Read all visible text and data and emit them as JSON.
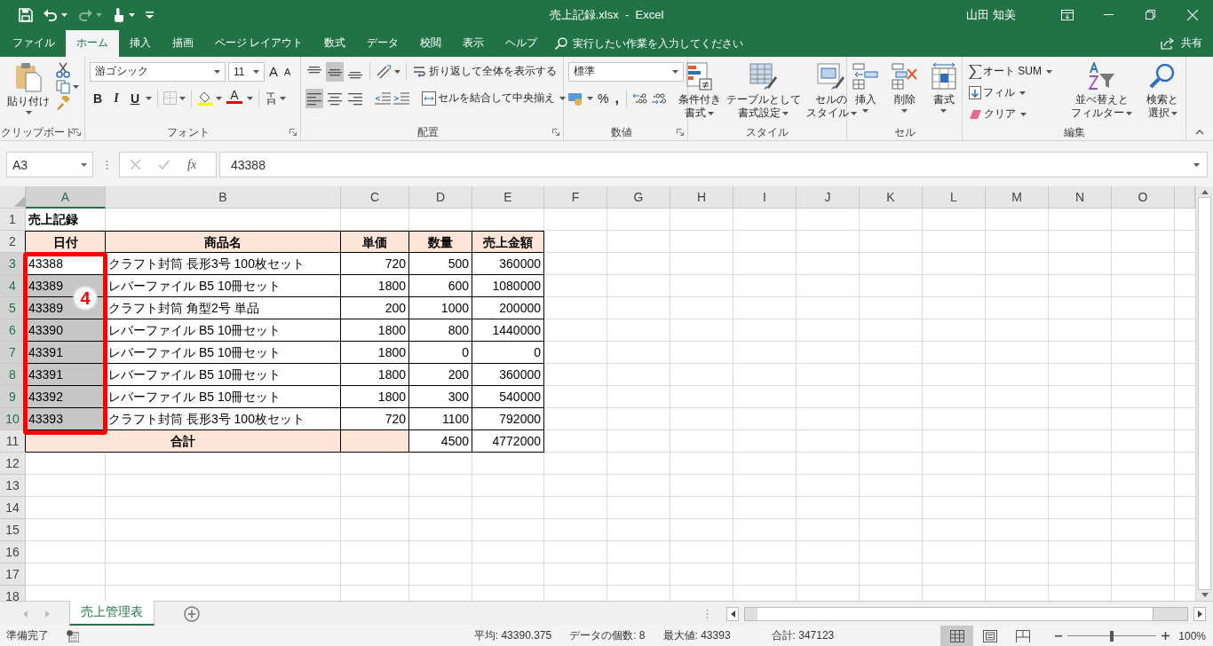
{
  "window": {
    "title": "売上記録.xlsx  -  Excel",
    "user": "山田 知美"
  },
  "ribbon_tabs": [
    {
      "label": "ファイル",
      "selected": false
    },
    {
      "label": "ホーム",
      "selected": true
    },
    {
      "label": "挿入",
      "selected": false
    },
    {
      "label": "描画",
      "selected": false
    },
    {
      "label": "ページ レイアウト",
      "selected": false
    },
    {
      "label": "数式",
      "selected": false
    },
    {
      "label": "データ",
      "selected": false
    },
    {
      "label": "校閲",
      "selected": false
    },
    {
      "label": "表示",
      "selected": false
    },
    {
      "label": "ヘルプ",
      "selected": false
    }
  ],
  "tell_me": {
    "placeholder": "実行したい作業を入力してください"
  },
  "share": "共有",
  "ribbon": {
    "paste": "貼り付け",
    "font_name": "游ゴシック",
    "font_size": "11",
    "grow_font": "A",
    "shrink_font": "A",
    "bold": "B",
    "italic": "I",
    "underline": "U",
    "font_color": "A",
    "align_buttons": [
      {
        "kind": "top",
        "selected": false
      },
      {
        "kind": "middle",
        "selected": true
      },
      {
        "kind": "bottom",
        "selected": false
      },
      {
        "kind": "left",
        "selected": true
      },
      {
        "kind": "center",
        "selected": false
      },
      {
        "kind": "right",
        "selected": false
      }
    ],
    "wrap_text": "折り返して全体を表示する",
    "merge_center": "セルを結合して中央揃え",
    "number_format": "標準",
    "percent": "%",
    "comma": ",",
    "style_buttons": [
      {
        "lines": [
          "条件付き",
          "書式"
        ]
      },
      {
        "lines": [
          "テーブルとして",
          "書式設定"
        ]
      },
      {
        "lines": [
          "セルの",
          "スタイル"
        ]
      }
    ],
    "cell_buttons": [
      "挿入",
      "削除",
      "書式"
    ],
    "autosum": "オート SUM",
    "fill": "フィル",
    "clear": "クリア",
    "sort_filter": [
      "並べ替えと",
      "フィルター"
    ],
    "find_select": [
      "検索と",
      "選択"
    ],
    "groups": [
      "クリップボード",
      "フォント",
      "配置",
      "数値",
      "スタイル",
      "セル",
      "編集"
    ]
  },
  "formula_bar": {
    "name_box": "A3",
    "function_button": "fx",
    "value": "43388"
  },
  "sheet": {
    "columns": [
      {
        "label": "A",
        "selected": true
      },
      {
        "label": "B",
        "selected": false
      },
      {
        "label": "C",
        "selected": false
      },
      {
        "label": "D",
        "selected": false
      },
      {
        "label": "E",
        "selected": false
      },
      {
        "label": "F",
        "selected": false
      },
      {
        "label": "G",
        "selected": false
      },
      {
        "label": "H",
        "selected": false
      },
      {
        "label": "I",
        "selected": false
      },
      {
        "label": "J",
        "selected": false
      },
      {
        "label": "K",
        "selected": false
      },
      {
        "label": "L",
        "selected": false
      },
      {
        "label": "M",
        "selected": false
      },
      {
        "label": "N",
        "selected": false
      },
      {
        "label": "O",
        "selected": false
      }
    ],
    "row_numbers": [
      {
        "label": "1",
        "selected": false
      },
      {
        "label": "2",
        "selected": false
      },
      {
        "label": "3",
        "selected": true
      },
      {
        "label": "4",
        "selected": true
      },
      {
        "label": "5",
        "selected": true
      },
      {
        "label": "6",
        "selected": true
      },
      {
        "label": "7",
        "selected": true
      },
      {
        "label": "8",
        "selected": true
      },
      {
        "label": "9",
        "selected": true
      },
      {
        "label": "10",
        "selected": true
      },
      {
        "label": "11",
        "selected": false
      },
      {
        "label": "12",
        "selected": false
      },
      {
        "label": "13",
        "selected": false
      },
      {
        "label": "14",
        "selected": false
      },
      {
        "label": "15",
        "selected": false
      },
      {
        "label": "16",
        "selected": false
      },
      {
        "label": "17",
        "selected": false
      },
      {
        "label": "18",
        "selected": false
      }
    ],
    "title": "売上記録",
    "headers": [
      "日付",
      "商品名",
      "単価",
      "数量",
      "売上金額"
    ],
    "records": [
      {
        "date": "43388",
        "product": "クラフト封筒 長形3号 100枚セット",
        "price": "720",
        "quantity": "500",
        "amount": "360000",
        "selected": false
      },
      {
        "date": "43389",
        "product": "レバーファイル B5 10冊セット",
        "price": "1800",
        "quantity": "600",
        "amount": "1080000",
        "selected": true
      },
      {
        "date": "43389",
        "product": "クラフト封筒 角型2号 単品",
        "price": "200",
        "quantity": "1000",
        "amount": "200000",
        "selected": true
      },
      {
        "date": "43390",
        "product": "レバーファイル B5 10冊セット",
        "price": "1800",
        "quantity": "800",
        "amount": "1440000",
        "selected": true
      },
      {
        "date": "43391",
        "product": "レバーファイル B5 10冊セット",
        "price": "1800",
        "quantity": "0",
        "amount": "0",
        "selected": true
      },
      {
        "date": "43391",
        "product": "レバーファイル B5 10冊セット",
        "price": "1800",
        "quantity": "200",
        "amount": "360000",
        "selected": true
      },
      {
        "date": "43392",
        "product": "レバーファイル B5 10冊セット",
        "price": "1800",
        "quantity": "300",
        "amount": "540000",
        "selected": true
      },
      {
        "date": "43393",
        "product": "クラフト封筒 長形3号 100枚セット",
        "price": "720",
        "quantity": "1100",
        "amount": "792000",
        "selected": true
      }
    ],
    "total": {
      "label": "合計",
      "quantity": "4500",
      "amount": "4772000"
    },
    "annotation": {
      "label": "4"
    }
  },
  "sheet_tabs": [
    {
      "label": "売上管理表",
      "selected": true
    }
  ],
  "status_bar": {
    "mode": "準備完了",
    "stats": [
      "平均: 43390.375",
      "データの個数: 8",
      "最大値: 43393",
      "合計: 347123"
    ],
    "views": [
      {
        "kind": "normal",
        "selected": true
      },
      {
        "kind": "page_layout",
        "selected": false
      },
      {
        "kind": "page_break",
        "selected": false
      }
    ],
    "zoom": {
      "level": 0.5,
      "label": "100%"
    }
  }
}
